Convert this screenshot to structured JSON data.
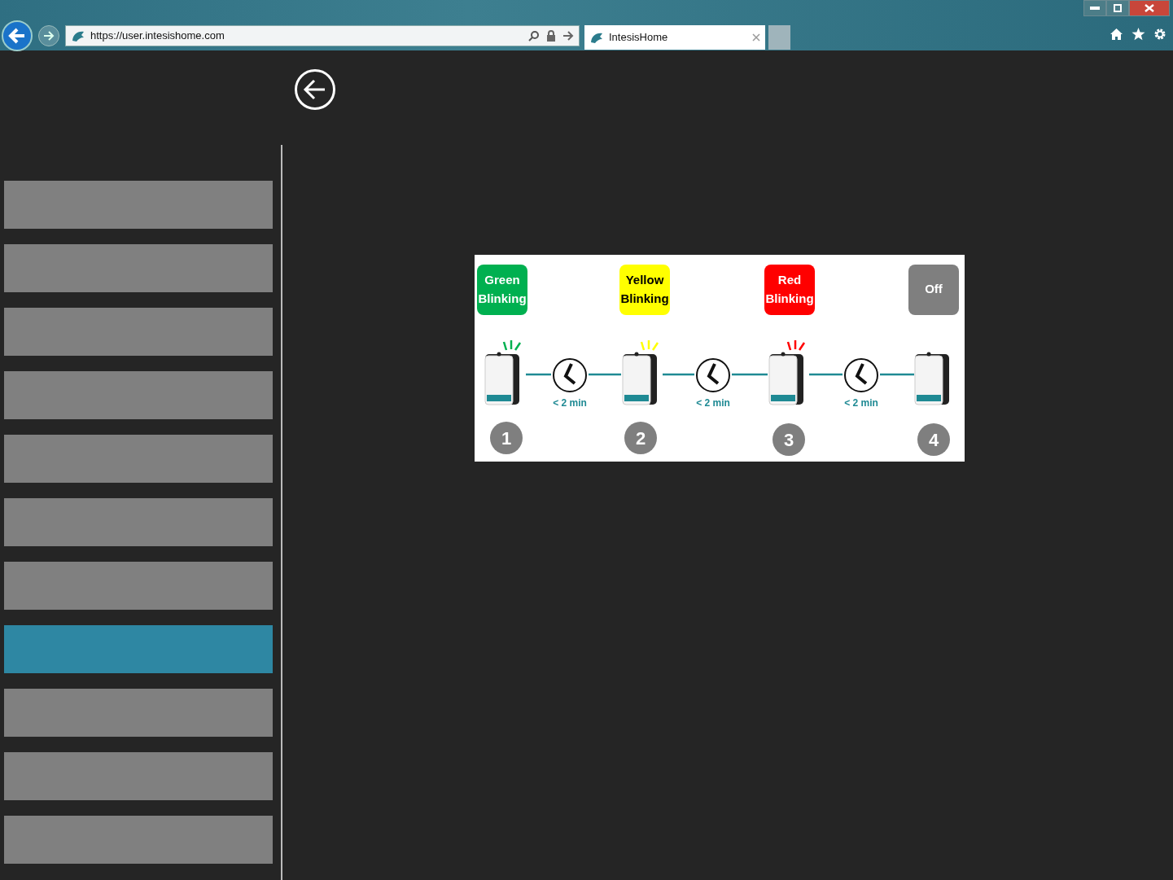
{
  "browser": {
    "address": "https://user.intesishome.com",
    "tab_title": "IntesisHome"
  },
  "sidebar": {
    "items": [
      {
        "selected": false
      },
      {
        "selected": false
      },
      {
        "selected": false
      },
      {
        "selected": false
      },
      {
        "selected": false
      },
      {
        "selected": false
      },
      {
        "selected": false
      },
      {
        "selected": true
      },
      {
        "selected": false
      },
      {
        "selected": false
      },
      {
        "selected": false
      }
    ]
  },
  "diagram": {
    "steps": [
      {
        "status": "Green Blinking",
        "color": "#00b050",
        "blinking": true,
        "number": "1"
      },
      {
        "status": "Yellow Blinking",
        "color": "#ffff00",
        "blinking": true,
        "number": "2"
      },
      {
        "status": "Red Blinking",
        "color": "#ff0000",
        "blinking": true,
        "number": "3"
      },
      {
        "status": "Off",
        "color": "#7f7f7f",
        "blinking": false,
        "number": "4"
      }
    ],
    "intervals": [
      "< 2 min",
      "< 2 min",
      "< 2 min"
    ]
  }
}
